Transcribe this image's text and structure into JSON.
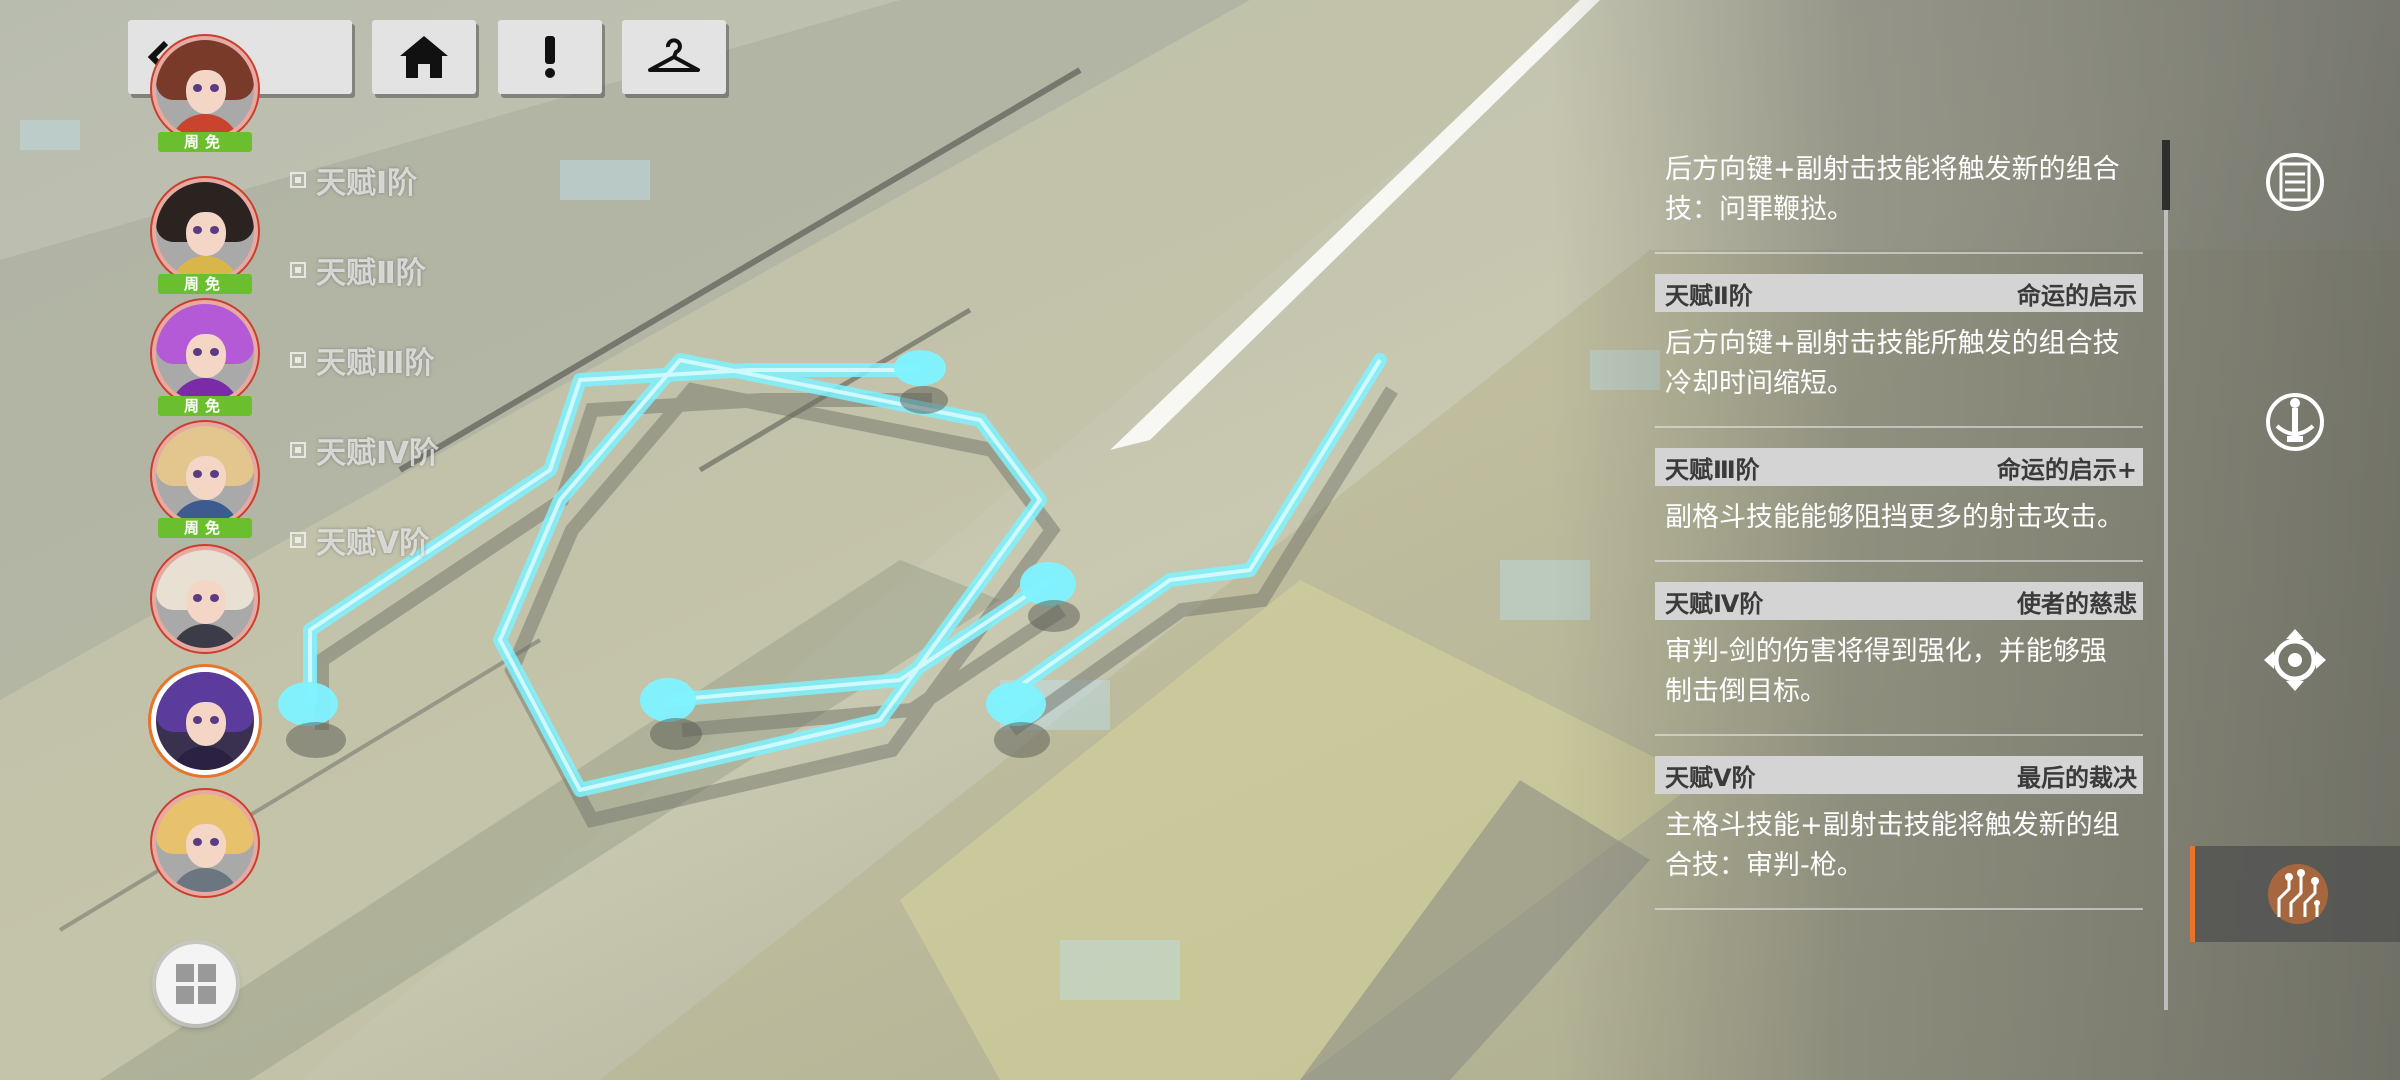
{
  "top_bar": {
    "back_icon": "back-arrow-diamond-icon",
    "home_icon": "home-icon",
    "alert_icon": "exclamation-icon",
    "wardrobe_icon": "hanger-icon"
  },
  "characters": [
    {
      "badge": "周免",
      "hair": "#7a3a2a",
      "body": "#c9432f"
    },
    {
      "badge": "周免",
      "hair": "#2a2320",
      "body": "#d9b64a"
    },
    {
      "badge": "周免",
      "hair": "#b45ad6",
      "body": "#7b2aa8"
    },
    {
      "badge": "周免",
      "hair": "#e3c58e",
      "body": "#3d5b8e"
    },
    {
      "badge": "",
      "hair": "#e8e0d2",
      "body": "#3c3c48"
    },
    {
      "badge": "",
      "hair": "#5b3b9c",
      "body": "#2a2240"
    },
    {
      "badge": "",
      "hair": "#e7c16c",
      "body": "#6b7680"
    }
  ],
  "tier_labels": [
    "天赋Ⅰ阶",
    "天赋Ⅱ阶",
    "天赋Ⅲ阶",
    "天赋Ⅳ阶",
    "天赋Ⅴ阶"
  ],
  "menu_icon": "grid-menu-icon",
  "talents": {
    "first_desc": "后方向键+副射击技能将触发新的组合技：问罪鞭挞。",
    "entries": [
      {
        "tier": "天赋Ⅱ阶",
        "name": "命运的启示",
        "desc": "后方向键+副射击技能所触发的组合技冷却时间缩短。"
      },
      {
        "tier": "天赋Ⅲ阶",
        "name": "命运的启示+",
        "desc": "副格斗技能能够阻挡更多的射击攻击。"
      },
      {
        "tier": "天赋Ⅳ阶",
        "name": "使者的慈悲",
        "desc": "审判-剑的伤害将得到强化，并能够强制击倒目标。"
      },
      {
        "tier": "天赋Ⅴ阶",
        "name": "最后的裁决",
        "desc": "主格斗技能+副射击技能将触发新的组合技：审判-枪。"
      }
    ]
  },
  "side_tabs": [
    {
      "icon": "info-list-icon",
      "active": false
    },
    {
      "icon": "weapon-stand-icon",
      "active": false
    },
    {
      "icon": "crosshair-gear-icon",
      "active": false
    },
    {
      "icon": "talent-circuit-icon",
      "active": true
    }
  ],
  "colors": {
    "accent_cyan": "#7ef3ff",
    "badge_green": "#6bbf2e",
    "active_tab_border": "#e8742c"
  }
}
